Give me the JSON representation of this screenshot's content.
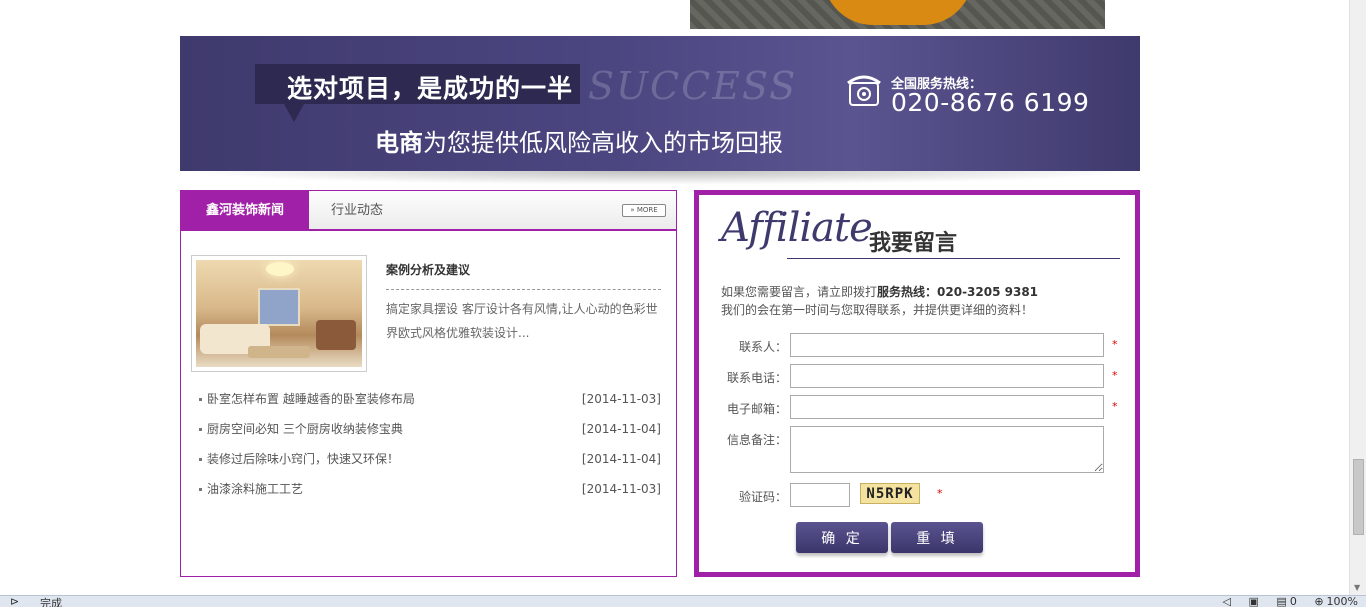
{
  "banner": {
    "headline": "选对项目，是成功的一半",
    "watermark": "SUCCESS",
    "subline_bold": "电商",
    "subline_rest": "为您提供低风险高收入的市场回报",
    "hotline_label": "全国服务热线：",
    "hotline_number": "020-8676 6199",
    "phone_icon": "phone-icon"
  },
  "news": {
    "tab_active": "鑫河装饰新闻",
    "tab_other": "行业动态",
    "more_label": "» MORE",
    "featured": {
      "title": "案例分析及建议",
      "desc": "搞定家具摆设 客厅设计各有风情,让人心动的色彩世界欧式风格优雅软装设计..."
    },
    "items": [
      {
        "title": "卧室怎样布置 越睡越香的卧室装修布局",
        "date": "[2014-11-03]"
      },
      {
        "title": "厨房空间必知 三个厨房收纳装修宝典",
        "date": "[2014-11-04]"
      },
      {
        "title": "装修过后除味小窍门，快速又环保！",
        "date": "[2014-11-04]"
      },
      {
        "title": "油漆涂料施工工艺",
        "date": "[2014-11-03]"
      }
    ]
  },
  "form": {
    "affiliate": "Affiliate",
    "title": "我要留言",
    "intro_line1_prefix": "如果您需要留言，请立即拨打",
    "intro_line1_bold": "服务热线：020-3205 9381",
    "intro_line2": "我们的会在第一时间与您取得联系，并提供更详细的资料！",
    "fields": {
      "contact": "联系人：",
      "phone": "联系电话：",
      "email": "电子邮箱：",
      "note": "信息备注：",
      "captcha": "验证码："
    },
    "required_mark": "*",
    "captcha_text": "N5RPK",
    "submit_label": "确 定",
    "reset_label": "重 填"
  },
  "statusbar": {
    "status": "完成",
    "counter": "0",
    "zoom": "100%"
  },
  "colors": {
    "accent": "#a020a8",
    "banner": "#4b4680"
  }
}
